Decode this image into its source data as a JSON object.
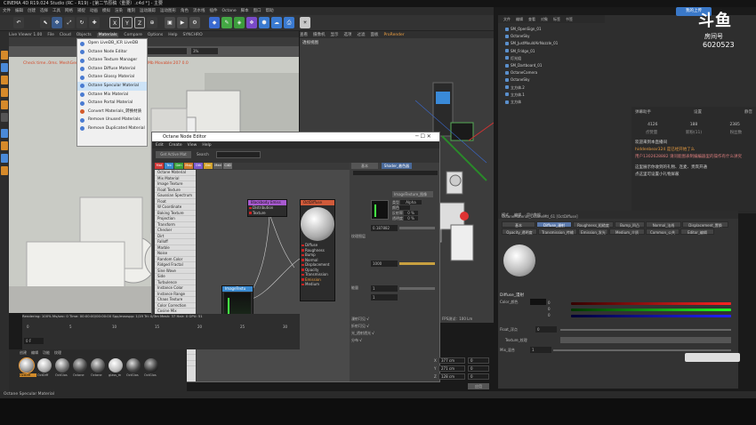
{
  "window": {
    "title": "CINEMA 4D R19.024 Studio (RC - R19) - [第二节原稿（重要）.c4d *] - 主要"
  },
  "menubar": [
    "文件",
    "编辑",
    "创建",
    "选择",
    "工具",
    "网格",
    "捕捉",
    "动画",
    "模拟",
    "渲染",
    "雕刻",
    "运动跟踪",
    "运动图形",
    "角色",
    "流水线",
    "插件",
    "Octane",
    "脚本",
    "窗口",
    "帮助"
  ],
  "viewport_left": {
    "menu": [
      "Live Viewer 1.00",
      "File",
      "Cloud",
      "Objects",
      "Materials",
      "Compare",
      "Options",
      "Help",
      "SYNCHRO"
    ],
    "overlay_text": "Check time..0ms. MeshGen",
    "overlay_text2": "Mailbox:0 Memory:0 P",
    "right_info": "Mb Movable:207  0.0",
    "dropdown_val": "PT",
    "zoom_val": "3%"
  },
  "context_menu": {
    "items": [
      {
        "label": "Open LiveDB_ICR LiveDB",
        "color": "#4a7bd1"
      },
      {
        "label": "Octane Node Editor",
        "color": "#4a7bd1"
      },
      {
        "label": "Octane Texture Manager",
        "color": "#4a7bd1"
      },
      {
        "label": "Octane Diffuse Material",
        "color": "#4a7bd1"
      },
      {
        "label": "Octane Glossy Material",
        "color": "#4a7bd1"
      },
      {
        "label": "Octane Specular Material",
        "color": "#4a7bd1",
        "selected": true
      },
      {
        "label": "Octane Mix Material",
        "color": "#4a7bd1"
      },
      {
        "label": "Octane Portal Material",
        "color": "#4a7bd1"
      },
      {
        "label": "Convert Materials_转换材质",
        "color": "#d35a2a"
      },
      {
        "label": "Remove Unused Materials",
        "color": "#4a7bd1"
      },
      {
        "label": "Remove Duplicated Material",
        "color": "#4a7bd1"
      }
    ]
  },
  "viewport_right": {
    "menu": [
      "查看",
      "摄像机",
      "显示",
      "选项",
      "过滤",
      "面板",
      "ProRender"
    ],
    "label": "透视视图",
    "fps": "FPS测试：100 Lm"
  },
  "node_editor": {
    "title": "Octane Node Editor",
    "menu": [
      "Edit",
      "Create",
      "View",
      "Help"
    ],
    "tool_buttons": [
      "Get Active Mat",
      "Search"
    ],
    "filter_tabs": [
      "Mat",
      "Tex",
      "Gen",
      "Map",
      "Oth",
      "Emi",
      "Med",
      "C4D"
    ],
    "node_list": [
      "Octane Material",
      "Mix Material",
      "Image Texture",
      "Float Texture",
      "Gaussian Spectrum",
      "Float",
      "W Coordinate",
      "Baking Texture",
      "Projection",
      "Transform",
      "Checker",
      "Dirt",
      "Falloff",
      "Marble",
      "Noise",
      "Random Color",
      "Ridged Fractal",
      "Sine Wave",
      "Side",
      "Turbulence",
      "Instance Color",
      "Instance Range",
      "Chaos Texture",
      "Color Correction",
      "Cosine Mix",
      "Gradient",
      "Invert",
      "Mix",
      "Multiply",
      "Add",
      "Subtract",
      "Compare",
      "Triplanar",
      "Clamp Texture"
    ],
    "nodes": {
      "blackbody": {
        "title": "Blackbody Emiss",
        "ports": [
          "Distribution",
          "Texture"
        ]
      },
      "diffuse": {
        "title": "OctDiffuse",
        "ports": [
          "Diffuse",
          "Roughness",
          "Bump",
          "Normal",
          "Displacement",
          "Opacity",
          "Transmission",
          "Emission",
          "Medium"
        ]
      },
      "imagetex": {
        "title": "ImageTextu",
        "ports": [
          "Power",
          "Transform",
          "Projection"
        ]
      }
    },
    "props": {
      "tabs": [
        "基本",
        "Shader_着色器"
      ],
      "header": "ImageTexture_图像",
      "rows": [
        {
          "label": "类型",
          "val": "Alpha"
        },
        {
          "label": "颜色",
          "val": ""
        },
        {
          "label": "反射率",
          "val": "0 %"
        },
        {
          "label": "透明度",
          "val": "0 %"
        }
      ],
      "float_val": "0.187882",
      "power_label": "能量",
      "power_val": "1",
      "power2_val": "1000",
      "tex_label": "纹理图层",
      "ok_label": "√",
      "checks": [
        "漫射可见",
        "折射可见",
        "光_透射透光",
        "分布"
      ]
    }
  },
  "object_manager": {
    "menu": [
      "文件",
      "编辑",
      "查看",
      "对象",
      "标签",
      "书签"
    ],
    "objects": [
      "SM_OpenSign_01",
      "OctaneSky",
      "SM_JustMouldAirNozzle_01",
      "SM_Fridge_01",
      "灯光组",
      "SM_Dartboard_01",
      "OctaneCamera",
      "OctaneSky",
      "立方体.2",
      "立方体.1",
      "立方体"
    ]
  },
  "chat": {
    "header": [
      "弹幕助手",
      "设置",
      "静音"
    ],
    "stats": [
      "4126",
      "188",
      "2385"
    ],
    "labels": [
      "点赞量",
      "新粉(11)",
      "粉丝数"
    ],
    "lines": [
      "欢迎来到本直播间",
      "hiddenbear324  是已经开始了么",
      "用户1302628882  请问能图表制编编器里的操作有什么讲究",
      "这里展示你收到的礼物、连麦、贵宾开通",
      "点这里可设置小礼物屏蔽"
    ]
  },
  "watermark": {
    "brand": "斗鱼",
    "room_label": "房间号",
    "room_no": "6020523",
    "upload": "我的上传"
  },
  "attr_manager": {
    "menu": [
      "模式",
      "编辑",
      "用户数据"
    ],
    "material": "OctaneMaterial_OctaneMtl_61 [OctDiffuse]",
    "tabs": [
      "基本",
      "Diffuse_漫射",
      "Roughness_粗糙度",
      "Bump_凹凸",
      "Normal_法线",
      "Displacement_置换",
      "Opacity_透明度",
      "Transmission_传输",
      "Emission_发光",
      "Medium_介质",
      "Common_公共",
      "Editor_编辑"
    ],
    "section": "Diffuse_漫射",
    "color_label": "Color_颜色",
    "rgb": [
      "0",
      "0",
      "0"
    ],
    "float_label": "Float_浮点",
    "float_val": "0",
    "texture_label": "Texture_纹理",
    "mix_label": "Mix_混合",
    "mix_val": "1"
  },
  "timeline": {
    "render_info": "Rendering: 100%  Ms/sec: 0  Time: 00:00:00/00:00:00  Spp/maxspp: 1/19  Tri: 0/3m  Mesh: 37  Hair: 0  GPU: 51",
    "ticks": [
      "0",
      "5",
      "10",
      "15",
      "20",
      "25",
      "30"
    ],
    "frame_field": "0 F",
    "frame_val": "0"
  },
  "materials": {
    "menu": [
      "创建",
      "编辑",
      "功能",
      "纹理"
    ],
    "items": [
      "OctDiff",
      "OctDiff",
      "OctGlos",
      "Octane",
      "Octane",
      "glass_m",
      "OctGlos",
      "OctGlos"
    ]
  },
  "coords": {
    "labels": [
      "X",
      "Y",
      "Z"
    ],
    "pos": [
      "377 cm",
      "271 cm",
      "128 cm"
    ],
    "rot": [
      "0",
      "0",
      "0"
    ],
    "apply": "应用"
  },
  "status": {
    "text": "Octane   Specular Material"
  }
}
